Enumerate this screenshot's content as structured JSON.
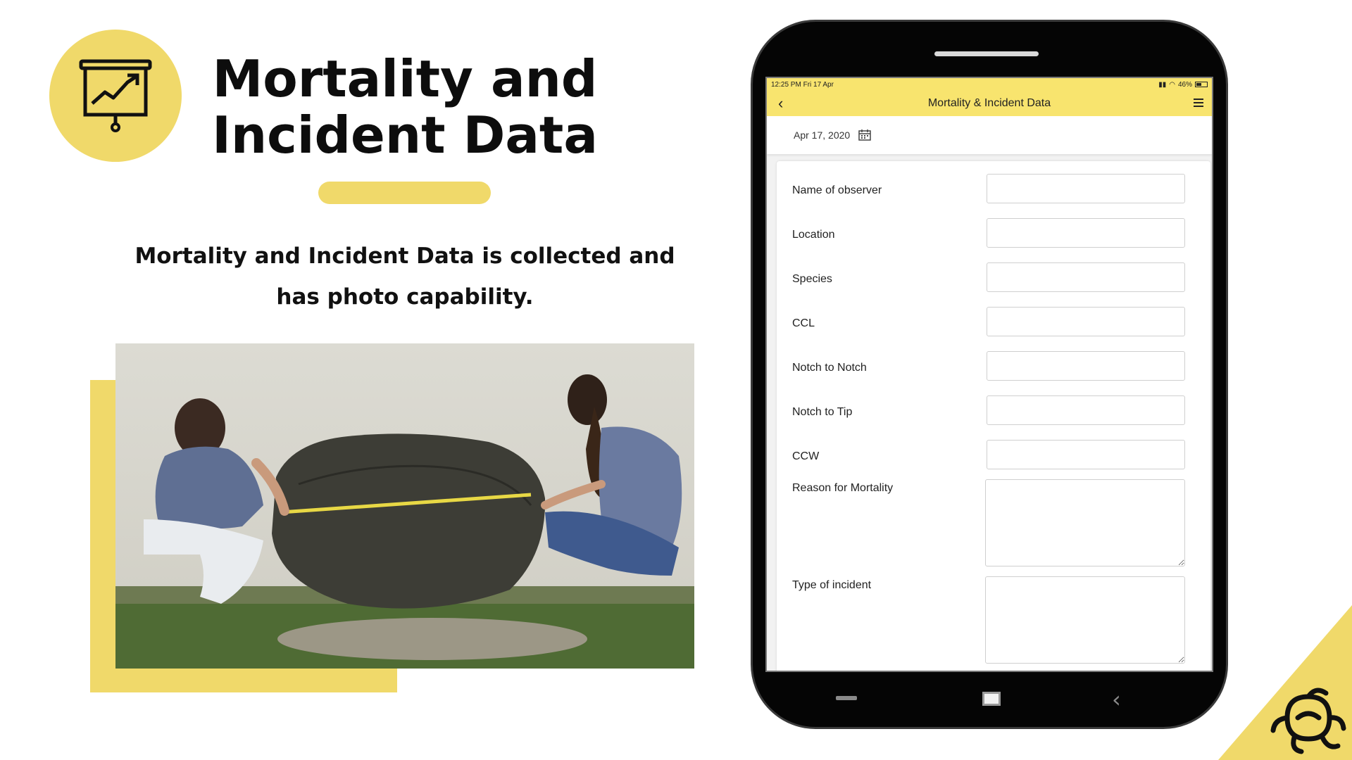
{
  "slide": {
    "title_line1": "Mortality and",
    "title_line2": "Incident Data",
    "subtitle_line1": "Mortality and Incident Data is collected and",
    "subtitle_line2": "has photo capability."
  },
  "icons": {
    "presentation": "presentation-chart-icon",
    "logo": "turtle-logo-icon"
  },
  "colors": {
    "accent": "#f0d96a",
    "app_bar": "#f8e46e",
    "phone_body": "#050505"
  },
  "app": {
    "status_time": "12:25 PM   Fri 17 Apr",
    "status_battery": "46%",
    "title": "Mortality & Incident Data",
    "date": "Apr 17, 2020",
    "fields": [
      {
        "label": "Name of observer",
        "value": ""
      },
      {
        "label": "Location",
        "value": ""
      },
      {
        "label": "Species",
        "value": ""
      },
      {
        "label": "CCL",
        "value": ""
      },
      {
        "label": "Notch to Notch",
        "value": ""
      },
      {
        "label": "Notch to Tip",
        "value": ""
      },
      {
        "label": "CCW",
        "value": ""
      },
      {
        "label": "Reason for Mortality",
        "value": ""
      },
      {
        "label": "Type of incident",
        "value": ""
      }
    ]
  }
}
